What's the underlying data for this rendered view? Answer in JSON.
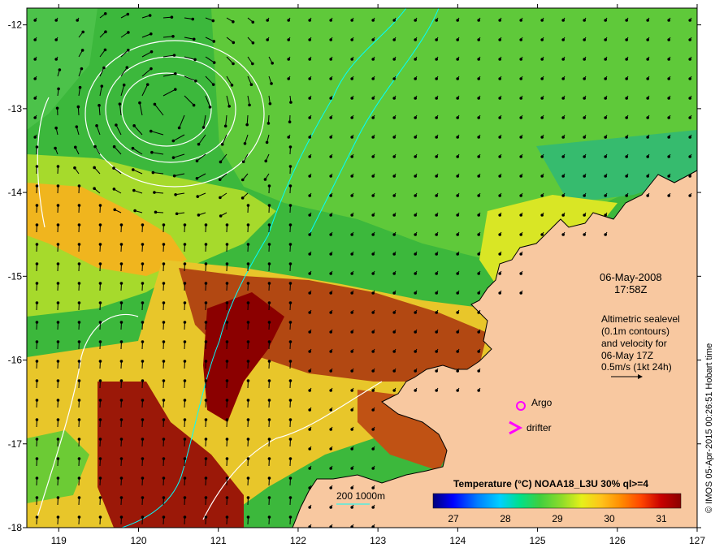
{
  "map": {
    "date_line": "06-May-2008",
    "time_line": "17:58Z",
    "info_lines": [
      "Altimetric sealevel",
      "(0.1m contours)",
      "and velocity for",
      "06-May 17Z",
      "0.5m/s (1kt 24h)"
    ],
    "markers": {
      "argo_label": "Argo",
      "drifter_label": "drifter",
      "argo_color": "#ff00ff",
      "drifter_color": "#ff00ff"
    },
    "bathymetry_label": "200  1000m",
    "credit": "© IMOS 05-Apr-2015 00:26:51 Hobart time",
    "colorbar": {
      "title": "Temperature (°C) NOAA18_L3U 30% ql>=4",
      "ticks": [
        "27",
        "28",
        "29",
        "30",
        "31"
      ],
      "colors": [
        "#00007a",
        "#0000ff",
        "#007fff",
        "#00d0ff",
        "#00e08a",
        "#3fcf3f",
        "#8fdc2a",
        "#e6f01a",
        "#ffc21a",
        "#ff8a00",
        "#ff4500",
        "#c80000",
        "#8b0000"
      ]
    },
    "land_color": "#f8c8a0",
    "sea_colors": {
      "green": "#3cb83c",
      "light_green": "#6fd33b",
      "yellow": "#e8ee2a",
      "orange": "#ef9a17",
      "brown": "#b54010",
      "darkred": "#8b0000",
      "teal": "#2fb58c",
      "blue": "#1e90ff"
    }
  },
  "chart_data": {
    "type": "map",
    "x_axis": {
      "label": "",
      "ticks": [
        "119",
        "120",
        "121",
        "122",
        "123",
        "124",
        "125",
        "126",
        "127"
      ],
      "range": [
        118.6,
        127
      ]
    },
    "y_axis": {
      "label": "",
      "ticks": [
        "-12",
        "-13",
        "-14",
        "-15",
        "-16",
        "-17",
        "-18"
      ],
      "range": [
        -18,
        -11.8
      ]
    }
  }
}
